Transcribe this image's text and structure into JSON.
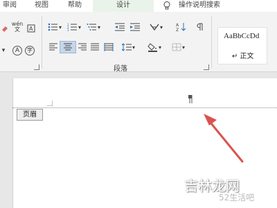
{
  "tabs": [
    {
      "label": "审阅",
      "active": false
    },
    {
      "label": "视图",
      "active": false
    },
    {
      "label": "帮助",
      "active": false
    },
    {
      "label": "设计",
      "active": true
    }
  ],
  "tell_me": {
    "label": "操作说明搜索",
    "icon": "lightbulb-icon"
  },
  "ribbon": {
    "font_row1": {
      "wen_label": "wén",
      "wen_char": "文"
    },
    "font_row2": {
      "a_label": "A",
      "char_label": "字"
    },
    "paragraph_group_label": "段落",
    "styles": {
      "sample_text": "AaBbCcDd",
      "name": "↵ 正文"
    }
  },
  "document": {
    "header_tag": "页眉"
  },
  "watermark": {
    "main": "吉林龙网",
    "sub": "52生活吧"
  },
  "accent": {
    "selected_button": "#c7d6ea",
    "active_tab": "#e9f3e9",
    "arrow": "#d9534f"
  }
}
